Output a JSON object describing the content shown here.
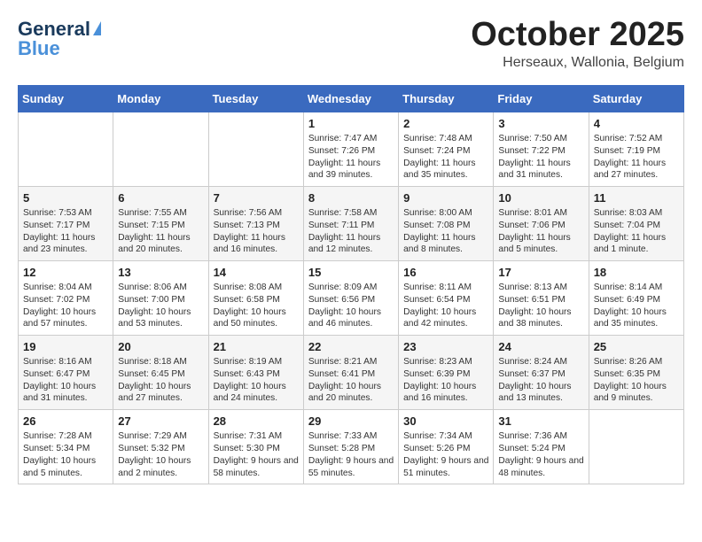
{
  "header": {
    "logo_general": "General",
    "logo_blue": "Blue",
    "month": "October 2025",
    "location": "Herseaux, Wallonia, Belgium"
  },
  "days_of_week": [
    "Sunday",
    "Monday",
    "Tuesday",
    "Wednesday",
    "Thursday",
    "Friday",
    "Saturday"
  ],
  "weeks": [
    [
      {
        "day": "",
        "content": ""
      },
      {
        "day": "",
        "content": ""
      },
      {
        "day": "",
        "content": ""
      },
      {
        "day": "1",
        "content": "Sunrise: 7:47 AM\nSunset: 7:26 PM\nDaylight: 11 hours\nand 39 minutes."
      },
      {
        "day": "2",
        "content": "Sunrise: 7:48 AM\nSunset: 7:24 PM\nDaylight: 11 hours\nand 35 minutes."
      },
      {
        "day": "3",
        "content": "Sunrise: 7:50 AM\nSunset: 7:22 PM\nDaylight: 11 hours\nand 31 minutes."
      },
      {
        "day": "4",
        "content": "Sunrise: 7:52 AM\nSunset: 7:19 PM\nDaylight: 11 hours\nand 27 minutes."
      }
    ],
    [
      {
        "day": "5",
        "content": "Sunrise: 7:53 AM\nSunset: 7:17 PM\nDaylight: 11 hours\nand 23 minutes."
      },
      {
        "day": "6",
        "content": "Sunrise: 7:55 AM\nSunset: 7:15 PM\nDaylight: 11 hours\nand 20 minutes."
      },
      {
        "day": "7",
        "content": "Sunrise: 7:56 AM\nSunset: 7:13 PM\nDaylight: 11 hours\nand 16 minutes."
      },
      {
        "day": "8",
        "content": "Sunrise: 7:58 AM\nSunset: 7:11 PM\nDaylight: 11 hours\nand 12 minutes."
      },
      {
        "day": "9",
        "content": "Sunrise: 8:00 AM\nSunset: 7:08 PM\nDaylight: 11 hours\nand 8 minutes."
      },
      {
        "day": "10",
        "content": "Sunrise: 8:01 AM\nSunset: 7:06 PM\nDaylight: 11 hours\nand 5 minutes."
      },
      {
        "day": "11",
        "content": "Sunrise: 8:03 AM\nSunset: 7:04 PM\nDaylight: 11 hours\nand 1 minute."
      }
    ],
    [
      {
        "day": "12",
        "content": "Sunrise: 8:04 AM\nSunset: 7:02 PM\nDaylight: 10 hours\nand 57 minutes."
      },
      {
        "day": "13",
        "content": "Sunrise: 8:06 AM\nSunset: 7:00 PM\nDaylight: 10 hours\nand 53 minutes."
      },
      {
        "day": "14",
        "content": "Sunrise: 8:08 AM\nSunset: 6:58 PM\nDaylight: 10 hours\nand 50 minutes."
      },
      {
        "day": "15",
        "content": "Sunrise: 8:09 AM\nSunset: 6:56 PM\nDaylight: 10 hours\nand 46 minutes."
      },
      {
        "day": "16",
        "content": "Sunrise: 8:11 AM\nSunset: 6:54 PM\nDaylight: 10 hours\nand 42 minutes."
      },
      {
        "day": "17",
        "content": "Sunrise: 8:13 AM\nSunset: 6:51 PM\nDaylight: 10 hours\nand 38 minutes."
      },
      {
        "day": "18",
        "content": "Sunrise: 8:14 AM\nSunset: 6:49 PM\nDaylight: 10 hours\nand 35 minutes."
      }
    ],
    [
      {
        "day": "19",
        "content": "Sunrise: 8:16 AM\nSunset: 6:47 PM\nDaylight: 10 hours\nand 31 minutes."
      },
      {
        "day": "20",
        "content": "Sunrise: 8:18 AM\nSunset: 6:45 PM\nDaylight: 10 hours\nand 27 minutes."
      },
      {
        "day": "21",
        "content": "Sunrise: 8:19 AM\nSunset: 6:43 PM\nDaylight: 10 hours\nand 24 minutes."
      },
      {
        "day": "22",
        "content": "Sunrise: 8:21 AM\nSunset: 6:41 PM\nDaylight: 10 hours\nand 20 minutes."
      },
      {
        "day": "23",
        "content": "Sunrise: 8:23 AM\nSunset: 6:39 PM\nDaylight: 10 hours\nand 16 minutes."
      },
      {
        "day": "24",
        "content": "Sunrise: 8:24 AM\nSunset: 6:37 PM\nDaylight: 10 hours\nand 13 minutes."
      },
      {
        "day": "25",
        "content": "Sunrise: 8:26 AM\nSunset: 6:35 PM\nDaylight: 10 hours\nand 9 minutes."
      }
    ],
    [
      {
        "day": "26",
        "content": "Sunrise: 7:28 AM\nSunset: 5:34 PM\nDaylight: 10 hours\nand 5 minutes."
      },
      {
        "day": "27",
        "content": "Sunrise: 7:29 AM\nSunset: 5:32 PM\nDaylight: 10 hours\nand 2 minutes."
      },
      {
        "day": "28",
        "content": "Sunrise: 7:31 AM\nSunset: 5:30 PM\nDaylight: 9 hours\nand 58 minutes."
      },
      {
        "day": "29",
        "content": "Sunrise: 7:33 AM\nSunset: 5:28 PM\nDaylight: 9 hours\nand 55 minutes."
      },
      {
        "day": "30",
        "content": "Sunrise: 7:34 AM\nSunset: 5:26 PM\nDaylight: 9 hours\nand 51 minutes."
      },
      {
        "day": "31",
        "content": "Sunrise: 7:36 AM\nSunset: 5:24 PM\nDaylight: 9 hours\nand 48 minutes."
      },
      {
        "day": "",
        "content": ""
      }
    ]
  ]
}
